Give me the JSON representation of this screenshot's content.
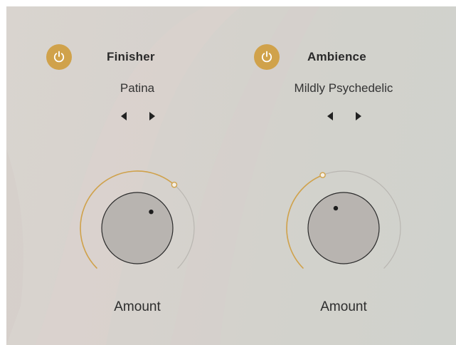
{
  "colors": {
    "accent": "#d0a24b",
    "track": "#b9b6b1",
    "knob_fill": "#b8b4b0",
    "text_dark": "#2a2a2a"
  },
  "modules": [
    {
      "title": "Finisher",
      "preset": "Patina",
      "power_on": true,
      "power_icon": "power-icon",
      "prev_icon": "triangle-left-icon",
      "next_icon": "triangle-right-icon",
      "knob_label": "Amount",
      "amount_value": 0.65
    },
    {
      "title": "Ambience",
      "preset": "Mildly Psychedelic",
      "power_on": true,
      "power_icon": "power-icon",
      "prev_icon": "triangle-left-icon",
      "next_icon": "triangle-right-icon",
      "knob_label": "Amount",
      "amount_value": 0.42
    }
  ]
}
